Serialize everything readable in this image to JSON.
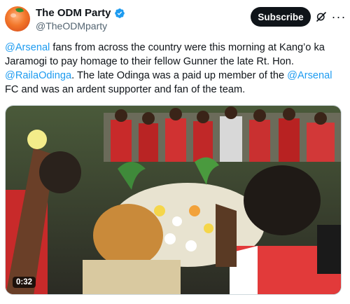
{
  "author": {
    "display_name": "The ODM Party",
    "handle": "@TheODMparty",
    "verified": true,
    "avatar_icon": "orange-fruit-avatar",
    "verified_color": "#1d9bf0"
  },
  "header": {
    "subscribe_label": "Subscribe",
    "grok_icon": "grok-icon",
    "more_icon": "more-options-icon"
  },
  "tweet": {
    "segments": [
      {
        "text": "@Arsenal",
        "type": "mention"
      },
      {
        "text": " fans from across the country were this morning at Kang’o ka Jaramogi to pay homage to their fellow Gunner the late Rt. Hon. ",
        "type": "text"
      },
      {
        "text": "@RailaOdinga",
        "type": "mention"
      },
      {
        "text": ". The late Odinga was a paid up member of the ",
        "type": "text"
      },
      {
        "text": "@Arsenal",
        "type": "mention"
      },
      {
        "text": " FC and was an ardent supporter and fan of the team.",
        "type": "text"
      }
    ],
    "mention_color": "#1d9bf0"
  },
  "media": {
    "type": "video",
    "duration": "0:32"
  }
}
